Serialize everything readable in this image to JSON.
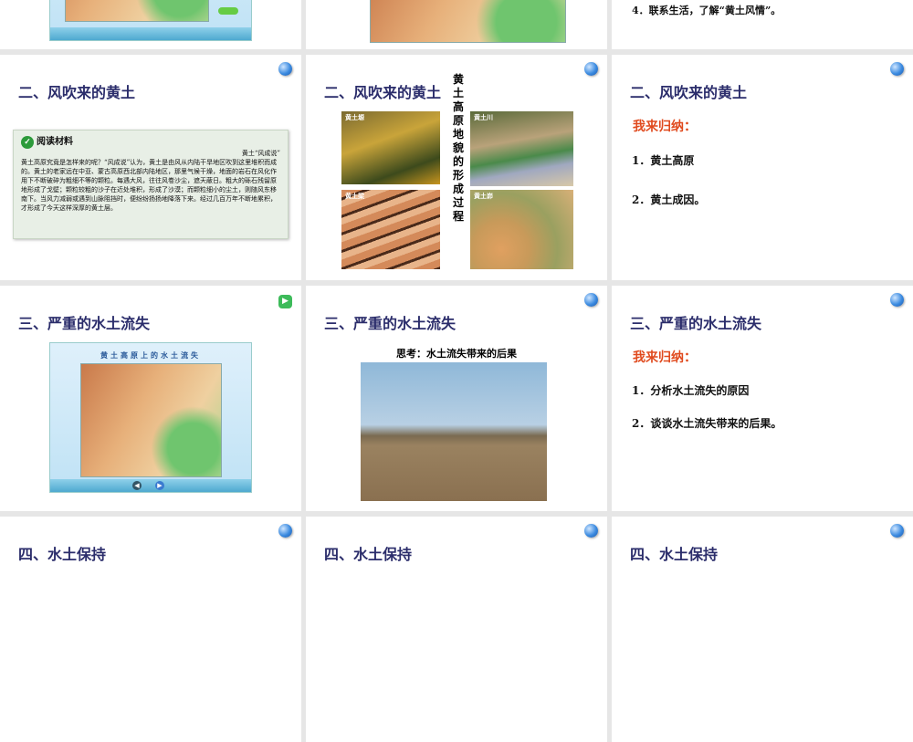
{
  "slides": {
    "s1": {},
    "s2": {},
    "s3": {
      "item": "4．联系生活，了解“黄土风情”。"
    },
    "s4": {
      "title": "二、风吹来的黄土",
      "reading_title": "阅读材料",
      "reading_heading": "黄土“风成说”",
      "reading_text": "黄土高原究竟是怎样来的呢？“风成说”认为，黄土是由风从内陆干旱地区吹到这里堆积而成的。黄土的老家远在中亚、蒙古高原西北部内陆地区，那里气候干燥，地面的岩石在风化作用下不断破碎为粗细不等的颗粒。每遇大风，往往风卷沙尘，遮天蔽日。粗大的砾石残留原地形成了戈壁；颗粒较粗的沙子在近处堆积，形成了沙漠；而颗粒细小的尘土，则随风东移南下。当风力减弱或遇到山脉阻挡时，便纷纷扬扬地降落下来。经过几百万年不断地累积，才形成了今天这样深厚的黄土层。"
    },
    "s5": {
      "title": "二、风吹来的黄土",
      "vertical": "黄土高原地貌的形成过程",
      "photos": [
        "黄土塬",
        "黄土川",
        "黄土梁",
        "黄土峁"
      ]
    },
    "s6": {
      "title": "二、风吹来的黄土",
      "sub": "我来归纳：",
      "items": [
        "1．黄土高原",
        "2．黄土成因。"
      ]
    },
    "s7": {
      "title": "三、严重的水土流失",
      "map_title": "黄土高原上的水土流失"
    },
    "s8": {
      "title": "三、严重的水土流失",
      "think": "思考：水土流失带来的后果"
    },
    "s9": {
      "title": "三、严重的水土流失",
      "sub": "我来归纳：",
      "items": [
        "1．分析水土流失的原因",
        "2．谈谈水土流失带来的后果。"
      ]
    },
    "s10": {
      "title": "四、水土保持"
    },
    "s11": {
      "title": "四、水土保持"
    },
    "s12": {
      "title": "四、水土保持"
    }
  },
  "colors": {
    "title": "#2b2d6b",
    "sub": "#e04a1e",
    "gap": "#e6e6e6"
  }
}
